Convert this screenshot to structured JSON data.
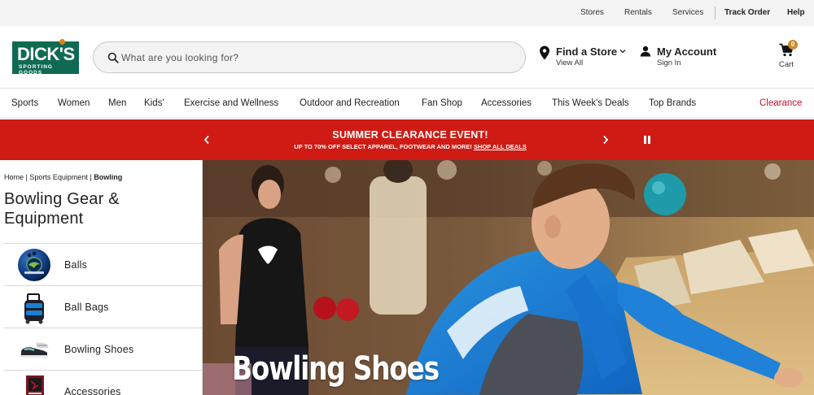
{
  "utility_nav": {
    "stores": "Stores",
    "rentals": "Rentals",
    "services": "Services",
    "track_order": "Track Order",
    "help": "Help"
  },
  "brand": {
    "logo_main": "DICK'S",
    "logo_sub": "SPORTING GOODS",
    "logo_color": "#0f6a53",
    "accent_color": "#e37d1c"
  },
  "search": {
    "placeholder": "What are you looking for?",
    "icon": "search-icon"
  },
  "store_finder": {
    "title": "Find a Store",
    "subtitle": "View All",
    "icon": "map-pin-icon"
  },
  "account": {
    "title": "My Account",
    "subtitle": "Sign In",
    "icon": "person-icon"
  },
  "cart": {
    "label": "Cart",
    "count": "0",
    "icon": "cart-icon"
  },
  "category_nav": {
    "items": [
      "Sports",
      "Women",
      "Men",
      "Kids'",
      "Exercise and Wellness",
      "Outdoor and Recreation",
      "Fan Shop",
      "Accessories",
      "This Week's Deals",
      "Top Brands"
    ],
    "clearance": "Clearance",
    "clearance_color": "#c8102e"
  },
  "promo": {
    "title": "SUMMER CLEARANCE EVENT!",
    "subtitle": "UP TO 70% OFF SELECT APPAREL, FOOTWEAR AND MORE!",
    "link": "SHOP ALL DEALS",
    "background_color": "#cf1b14"
  },
  "breadcrumb": {
    "home": "Home",
    "sep1": " | ",
    "parent": "Sports Equipment",
    "sep2": " | ",
    "current": "Bowling"
  },
  "page": {
    "title": "Bowling Gear & Equipment"
  },
  "subcategories": [
    {
      "label": "Balls",
      "thumb": "bowling-ball-thumbnail"
    },
    {
      "label": "Ball Bags",
      "thumb": "ball-bag-thumbnail"
    },
    {
      "label": "Bowling Shoes",
      "thumb": "bowling-shoes-thumbnail"
    },
    {
      "label": "Accessories",
      "thumb": "accessories-thumbnail"
    }
  ],
  "hero": {
    "title": "Bowling Shoes"
  }
}
